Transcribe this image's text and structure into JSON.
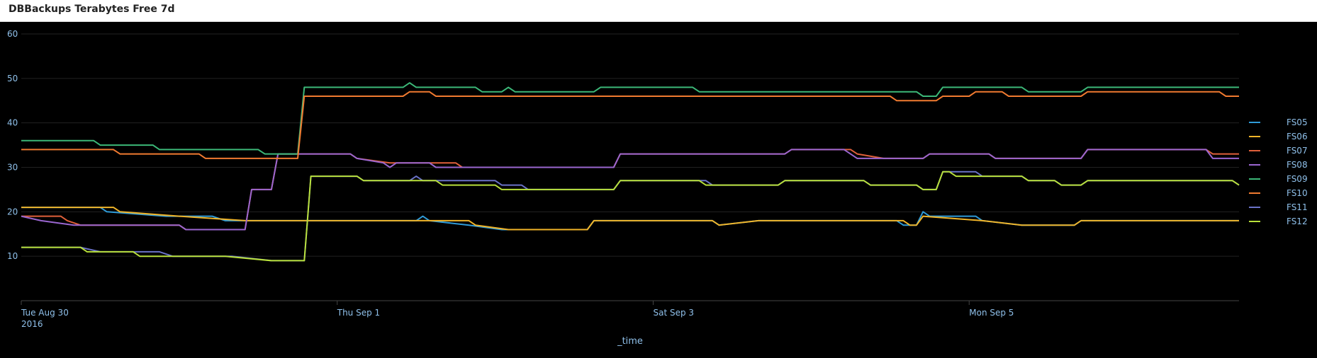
{
  "panel": {
    "title": "DBBackups Terabytes Free 7d"
  },
  "chart_data": {
    "type": "line",
    "title": "DBBackups Terabytes Free 7d",
    "xlabel": "_time",
    "ylabel": "",
    "ylim": [
      0,
      60
    ],
    "yticks": [
      10,
      20,
      30,
      40,
      50,
      60
    ],
    "grid": true,
    "legend": "right",
    "xlim": [
      "2016-08-30T00:00",
      "2016-09-06T17:00"
    ],
    "xticks": [
      {
        "x": "2016-08-30T00:00",
        "label": "Tue Aug 30",
        "sublabel": "2016"
      },
      {
        "x": "2016-09-01T00:00",
        "label": "Thu Sep 1"
      },
      {
        "x": "2016-09-03T00:00",
        "label": "Sat Sep 3"
      },
      {
        "x": "2016-09-05T00:00",
        "label": "Mon Sep 5"
      }
    ],
    "series": [
      {
        "name": "FS05",
        "color": "#2f9bd8",
        "points": [
          [
            "2016-08-30T00:00",
            21
          ],
          [
            "2016-08-30T12:00",
            21
          ],
          [
            "2016-08-30T13:00",
            20
          ],
          [
            "2016-08-30T22:00",
            19
          ],
          [
            "2016-08-31T05:00",
            19
          ],
          [
            "2016-08-31T07:00",
            18
          ],
          [
            "2016-09-01T12:00",
            18
          ],
          [
            "2016-09-01T13:00",
            19
          ],
          [
            "2016-09-01T14:00",
            18
          ],
          [
            "2016-09-01T20:00",
            17
          ],
          [
            "2016-09-02T01:00",
            16
          ],
          [
            "2016-09-02T14:00",
            16
          ],
          [
            "2016-09-02T15:00",
            18
          ],
          [
            "2016-09-03T09:00",
            18
          ],
          [
            "2016-09-03T10:00",
            17
          ],
          [
            "2016-09-03T16:00",
            18
          ],
          [
            "2016-09-04T13:00",
            18
          ],
          [
            "2016-09-04T14:00",
            17
          ],
          [
            "2016-09-04T16:00",
            17
          ],
          [
            "2016-09-04T17:00",
            20
          ],
          [
            "2016-09-04T18:00",
            19
          ],
          [
            "2016-09-05T01:00",
            19
          ],
          [
            "2016-09-05T02:00",
            18
          ],
          [
            "2016-09-05T08:00",
            17
          ],
          [
            "2016-09-05T16:00",
            17
          ],
          [
            "2016-09-05T17:00",
            18
          ],
          [
            "2016-09-06T17:00",
            18
          ]
        ]
      },
      {
        "name": "FS06",
        "color": "#f0b429",
        "points": [
          [
            "2016-08-30T00:00",
            21
          ],
          [
            "2016-08-30T14:00",
            21
          ],
          [
            "2016-08-30T15:00",
            20
          ],
          [
            "2016-08-31T00:00",
            19
          ],
          [
            "2016-08-31T10:00",
            18
          ],
          [
            "2016-09-01T20:00",
            18
          ],
          [
            "2016-09-01T21:00",
            17
          ],
          [
            "2016-09-02T02:00",
            16
          ],
          [
            "2016-09-02T14:00",
            16
          ],
          [
            "2016-09-02T15:00",
            18
          ],
          [
            "2016-09-03T09:00",
            18
          ],
          [
            "2016-09-03T10:00",
            17
          ],
          [
            "2016-09-03T16:00",
            18
          ],
          [
            "2016-09-04T14:00",
            18
          ],
          [
            "2016-09-04T15:00",
            17
          ],
          [
            "2016-09-04T16:00",
            17
          ],
          [
            "2016-09-04T17:00",
            19
          ],
          [
            "2016-09-05T02:00",
            18
          ],
          [
            "2016-09-05T08:00",
            17
          ],
          [
            "2016-09-05T16:00",
            17
          ],
          [
            "2016-09-05T17:00",
            18
          ],
          [
            "2016-09-06T17:00",
            18
          ]
        ]
      },
      {
        "name": "FS07",
        "color": "#e0603a",
        "points": [
          [
            "2016-08-30T00:00",
            19
          ],
          [
            "2016-08-30T06:00",
            19
          ],
          [
            "2016-08-30T07:00",
            18
          ],
          [
            "2016-08-30T09:00",
            17
          ],
          [
            "2016-08-31T00:00",
            17
          ],
          [
            "2016-08-31T01:00",
            16
          ],
          [
            "2016-08-31T10:00",
            16
          ],
          [
            "2016-08-31T11:00",
            25
          ],
          [
            "2016-08-31T14:00",
            25
          ],
          [
            "2016-08-31T15:00",
            33
          ],
          [
            "2016-09-01T02:00",
            33
          ],
          [
            "2016-09-01T03:00",
            32
          ],
          [
            "2016-09-01T08:00",
            31
          ],
          [
            "2016-09-01T18:00",
            31
          ],
          [
            "2016-09-01T19:00",
            30
          ],
          [
            "2016-09-02T18:00",
            30
          ],
          [
            "2016-09-02T19:00",
            33
          ],
          [
            "2016-09-03T20:00",
            33
          ],
          [
            "2016-09-03T21:00",
            34
          ],
          [
            "2016-09-04T06:00",
            34
          ],
          [
            "2016-09-04T07:00",
            33
          ],
          [
            "2016-09-04T11:00",
            32
          ],
          [
            "2016-09-04T17:00",
            32
          ],
          [
            "2016-09-04T18:00",
            33
          ],
          [
            "2016-09-05T03:00",
            33
          ],
          [
            "2016-09-05T04:00",
            32
          ],
          [
            "2016-09-05T17:00",
            32
          ],
          [
            "2016-09-05T18:00",
            34
          ],
          [
            "2016-09-06T12:00",
            34
          ],
          [
            "2016-09-06T13:00",
            33
          ],
          [
            "2016-09-06T17:00",
            33
          ]
        ]
      },
      {
        "name": "FS08",
        "color": "#9a66d0",
        "points": [
          [
            "2016-08-30T00:00",
            19
          ],
          [
            "2016-08-30T03:00",
            18
          ],
          [
            "2016-08-30T08:00",
            17
          ],
          [
            "2016-08-31T00:00",
            17
          ],
          [
            "2016-08-31T01:00",
            16
          ],
          [
            "2016-08-31T10:00",
            16
          ],
          [
            "2016-08-31T11:00",
            25
          ],
          [
            "2016-08-31T14:00",
            25
          ],
          [
            "2016-08-31T15:00",
            33
          ],
          [
            "2016-09-01T02:00",
            33
          ],
          [
            "2016-09-01T03:00",
            32
          ],
          [
            "2016-09-01T07:00",
            31
          ],
          [
            "2016-09-01T08:00",
            30
          ],
          [
            "2016-09-01T09:00",
            31
          ],
          [
            "2016-09-01T14:00",
            31
          ],
          [
            "2016-09-01T15:00",
            30
          ],
          [
            "2016-09-02T18:00",
            30
          ],
          [
            "2016-09-02T19:00",
            33
          ],
          [
            "2016-09-03T20:00",
            33
          ],
          [
            "2016-09-03T21:00",
            34
          ],
          [
            "2016-09-04T05:00",
            34
          ],
          [
            "2016-09-04T07:00",
            32
          ],
          [
            "2016-09-04T17:00",
            32
          ],
          [
            "2016-09-04T18:00",
            33
          ],
          [
            "2016-09-05T03:00",
            33
          ],
          [
            "2016-09-05T04:00",
            32
          ],
          [
            "2016-09-05T17:00",
            32
          ],
          [
            "2016-09-05T18:00",
            34
          ],
          [
            "2016-09-06T12:00",
            34
          ],
          [
            "2016-09-06T13:00",
            32
          ],
          [
            "2016-09-06T17:00",
            32
          ]
        ]
      },
      {
        "name": "FS09",
        "color": "#3cb878",
        "points": [
          [
            "2016-08-30T00:00",
            36
          ],
          [
            "2016-08-30T11:00",
            36
          ],
          [
            "2016-08-30T12:00",
            35
          ],
          [
            "2016-08-30T20:00",
            35
          ],
          [
            "2016-08-30T21:00",
            34
          ],
          [
            "2016-08-31T12:00",
            34
          ],
          [
            "2016-08-31T13:00",
            33
          ],
          [
            "2016-08-31T18:00",
            33
          ],
          [
            "2016-08-31T19:00",
            48
          ],
          [
            "2016-09-01T10:00",
            48
          ],
          [
            "2016-09-01T11:00",
            49
          ],
          [
            "2016-09-01T12:00",
            48
          ],
          [
            "2016-09-01T21:00",
            48
          ],
          [
            "2016-09-01T22:00",
            47
          ],
          [
            "2016-09-02T01:00",
            47
          ],
          [
            "2016-09-02T02:00",
            48
          ],
          [
            "2016-09-02T03:00",
            47
          ],
          [
            "2016-09-02T15:00",
            47
          ],
          [
            "2016-09-02T16:00",
            48
          ],
          [
            "2016-09-03T06:00",
            48
          ],
          [
            "2016-09-03T07:00",
            47
          ],
          [
            "2016-09-04T16:00",
            47
          ],
          [
            "2016-09-04T17:00",
            46
          ],
          [
            "2016-09-04T19:00",
            46
          ],
          [
            "2016-09-04T20:00",
            48
          ],
          [
            "2016-09-05T08:00",
            48
          ],
          [
            "2016-09-05T09:00",
            47
          ],
          [
            "2016-09-05T17:00",
            47
          ],
          [
            "2016-09-05T18:00",
            48
          ],
          [
            "2016-09-06T17:00",
            48
          ]
        ]
      },
      {
        "name": "FS10",
        "color": "#f07a30",
        "points": [
          [
            "2016-08-30T00:00",
            34
          ],
          [
            "2016-08-30T14:00",
            34
          ],
          [
            "2016-08-30T15:00",
            33
          ],
          [
            "2016-08-31T03:00",
            33
          ],
          [
            "2016-08-31T04:00",
            32
          ],
          [
            "2016-08-31T18:00",
            32
          ],
          [
            "2016-08-31T19:00",
            46
          ],
          [
            "2016-09-01T10:00",
            46
          ],
          [
            "2016-09-01T11:00",
            47
          ],
          [
            "2016-09-01T14:00",
            47
          ],
          [
            "2016-09-01T15:00",
            46
          ],
          [
            "2016-09-04T12:00",
            46
          ],
          [
            "2016-09-04T13:00",
            45
          ],
          [
            "2016-09-04T19:00",
            45
          ],
          [
            "2016-09-04T20:00",
            46
          ],
          [
            "2016-09-05T00:00",
            46
          ],
          [
            "2016-09-05T01:00",
            47
          ],
          [
            "2016-09-05T05:00",
            47
          ],
          [
            "2016-09-05T06:00",
            46
          ],
          [
            "2016-09-05T17:00",
            46
          ],
          [
            "2016-09-05T18:00",
            47
          ],
          [
            "2016-09-06T14:00",
            47
          ],
          [
            "2016-09-06T15:00",
            46
          ],
          [
            "2016-09-06T17:00",
            46
          ]
        ]
      },
      {
        "name": "FS11",
        "color": "#6a72c8",
        "points": [
          [
            "2016-08-30T00:00",
            12
          ],
          [
            "2016-08-30T09:00",
            12
          ],
          [
            "2016-08-30T12:00",
            11
          ],
          [
            "2016-08-30T21:00",
            11
          ],
          [
            "2016-08-30T23:00",
            10
          ],
          [
            "2016-08-31T08:00",
            10
          ],
          [
            "2016-08-31T14:00",
            9
          ],
          [
            "2016-08-31T19:00",
            9
          ],
          [
            "2016-08-31T20:00",
            28
          ],
          [
            "2016-09-01T03:00",
            28
          ],
          [
            "2016-09-01T04:00",
            27
          ],
          [
            "2016-09-01T11:00",
            27
          ],
          [
            "2016-09-01T12:00",
            28
          ],
          [
            "2016-09-01T13:00",
            27
          ],
          [
            "2016-09-02T00:00",
            27
          ],
          [
            "2016-09-02T01:00",
            26
          ],
          [
            "2016-09-02T04:00",
            26
          ],
          [
            "2016-09-02T05:00",
            25
          ],
          [
            "2016-09-02T18:00",
            25
          ],
          [
            "2016-09-02T19:00",
            27
          ],
          [
            "2016-09-03T08:00",
            27
          ],
          [
            "2016-09-03T09:00",
            26
          ],
          [
            "2016-09-03T19:00",
            26
          ],
          [
            "2016-09-03T20:00",
            27
          ],
          [
            "2016-09-04T08:00",
            27
          ],
          [
            "2016-09-04T09:00",
            26
          ],
          [
            "2016-09-04T16:00",
            26
          ],
          [
            "2016-09-04T17:00",
            25
          ],
          [
            "2016-09-04T19:00",
            25
          ],
          [
            "2016-09-04T20:00",
            29
          ],
          [
            "2016-09-05T01:00",
            29
          ],
          [
            "2016-09-05T02:00",
            28
          ],
          [
            "2016-09-05T08:00",
            28
          ],
          [
            "2016-09-05T09:00",
            27
          ],
          [
            "2016-09-05T13:00",
            27
          ],
          [
            "2016-09-05T14:00",
            26
          ],
          [
            "2016-09-05T17:00",
            26
          ],
          [
            "2016-09-05T18:00",
            27
          ],
          [
            "2016-09-06T16:00",
            27
          ],
          [
            "2016-09-06T17:00",
            26
          ]
        ]
      },
      {
        "name": "FS12",
        "color": "#b8e03a",
        "points": [
          [
            "2016-08-30T00:00",
            12
          ],
          [
            "2016-08-30T09:00",
            12
          ],
          [
            "2016-08-30T10:00",
            11
          ],
          [
            "2016-08-30T17:00",
            11
          ],
          [
            "2016-08-30T18:00",
            10
          ],
          [
            "2016-08-31T07:00",
            10
          ],
          [
            "2016-08-31T14:00",
            9
          ],
          [
            "2016-08-31T19:00",
            9
          ],
          [
            "2016-08-31T20:00",
            28
          ],
          [
            "2016-09-01T03:00",
            28
          ],
          [
            "2016-09-01T04:00",
            27
          ],
          [
            "2016-09-01T15:00",
            27
          ],
          [
            "2016-09-01T16:00",
            26
          ],
          [
            "2016-09-02T00:00",
            26
          ],
          [
            "2016-09-02T01:00",
            25
          ],
          [
            "2016-09-02T18:00",
            25
          ],
          [
            "2016-09-02T19:00",
            27
          ],
          [
            "2016-09-03T07:00",
            27
          ],
          [
            "2016-09-03T08:00",
            26
          ],
          [
            "2016-09-03T19:00",
            26
          ],
          [
            "2016-09-03T20:00",
            27
          ],
          [
            "2016-09-04T08:00",
            27
          ],
          [
            "2016-09-04T09:00",
            26
          ],
          [
            "2016-09-04T16:00",
            26
          ],
          [
            "2016-09-04T17:00",
            25
          ],
          [
            "2016-09-04T19:00",
            25
          ],
          [
            "2016-09-04T20:00",
            29
          ],
          [
            "2016-09-04T21:00",
            29
          ],
          [
            "2016-09-04T22:00",
            28
          ],
          [
            "2016-09-05T08:00",
            28
          ],
          [
            "2016-09-05T09:00",
            27
          ],
          [
            "2016-09-05T13:00",
            27
          ],
          [
            "2016-09-05T14:00",
            26
          ],
          [
            "2016-09-05T17:00",
            26
          ],
          [
            "2016-09-05T18:00",
            27
          ],
          [
            "2016-09-06T16:00",
            27
          ],
          [
            "2016-09-06T17:00",
            26
          ]
        ]
      }
    ]
  }
}
